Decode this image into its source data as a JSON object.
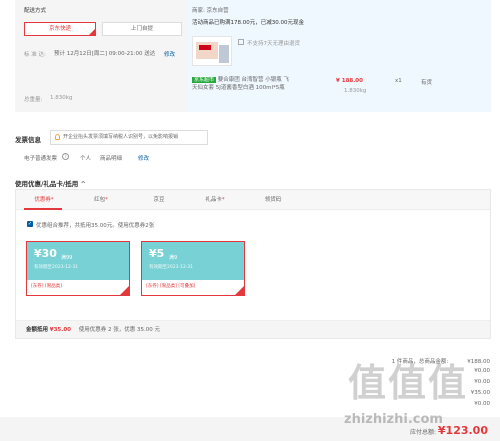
{
  "delivery": {
    "title": "配送方式",
    "option_jd": "京东快递",
    "option_pickup": "上门自提",
    "time_label": "标  准  达:",
    "time_value": "预计 12月12日[周二] 09:00-21:00 送达",
    "modify": "修改",
    "weight_label": "总重量:",
    "weight_value": "1.830kg"
  },
  "shop": {
    "merchant": "商家: 京东自营",
    "promo": "活动商品已购满178.00元，已减30.00元现金",
    "no_return": "不支持7天无理由退货",
    "item_tag": "京东超市",
    "item_name": "要合康团 台湾智营 小银瓶 飞天仙女套 5J道酱香型白酒 100ml*5瓶",
    "price": "¥ 188.00",
    "qty": "x1",
    "stock": "有货",
    "weight": "1.830kg"
  },
  "invoice": {
    "title": "发票信息",
    "notice": "开企业抬头发票须填写纳税人识别号，以免影响报销",
    "type": "电子普通发票",
    "person": "个人",
    "detail": "商品明细",
    "modify": "修改"
  },
  "coupons": {
    "title": "使用优惠/礼品卡/抵用",
    "toggle": "^",
    "tabs": [
      "优惠券",
      "红包",
      "京豆",
      "礼品卡",
      "领货码"
    ],
    "tab_marks": [
      "*",
      "*",
      "",
      "*",
      ""
    ],
    "combo": "优惠组合推荐，共抵用35.00元。使用优惠券2张",
    "items": [
      {
        "amount": "¥30",
        "cond": "满99",
        "valid": "有效期至2023-12-31",
        "scope": "[东券]  [限品类]"
      },
      {
        "amount": "¥5",
        "cond": "满9",
        "valid": "有效期至2023-12-31",
        "scope": "[东券]  [限品类]  [可叠加]"
      }
    ],
    "summary_label": "金额抵用",
    "summary_amount": "¥35.00",
    "summary_text": "使用优惠券 2 张，优惠 35.00 元"
  },
  "totals": {
    "goods_label": "1 件商品，总商品金额:",
    "goods_value": "¥188.00",
    "row2": "¥0.00",
    "row3": "¥0.00",
    "row4": "¥35.00",
    "row5": "¥0.00",
    "payable_label": "应付总额:",
    "payable_value": "¥123.00"
  },
  "watermark": {
    "glyphs": "值值值",
    "site": "zhizhizhi.com"
  }
}
